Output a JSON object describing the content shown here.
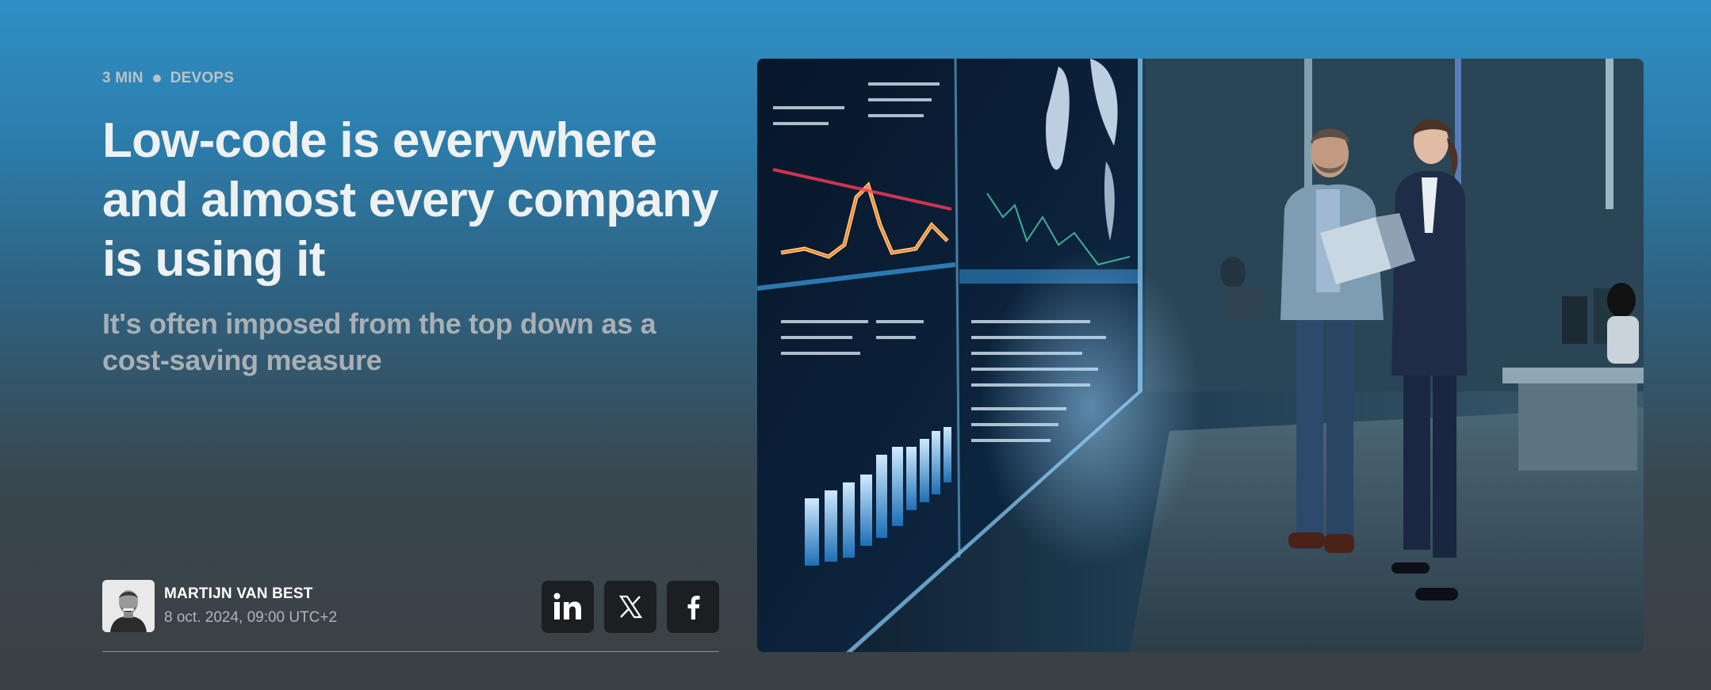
{
  "article": {
    "read_time": "3 MIN",
    "category": "DEVOPS",
    "title": "Low-code is everywhere and almost every company is using it",
    "subtitle": "It's often imposed from the top down as a cost-saving measure"
  },
  "author": {
    "name": "MARTIJN VAN BEST",
    "date": "8 oct. 2024, 09:00 UTC+2"
  },
  "share": [
    {
      "icon": "linkedin-icon"
    },
    {
      "icon": "x-icon"
    },
    {
      "icon": "facebook-icon"
    }
  ],
  "colors": {
    "bg_top": "#2f8fc4",
    "bg_bottom": "#3a4043",
    "button_bg": "#1c1f21",
    "title": "#eef1f2"
  }
}
